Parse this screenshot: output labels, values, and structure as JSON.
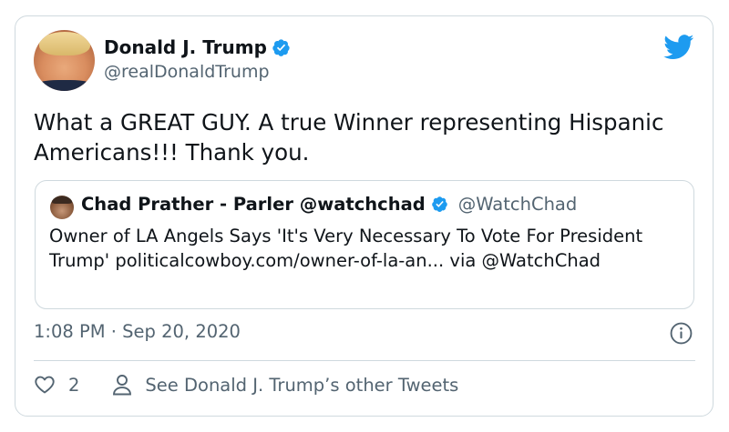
{
  "author": {
    "name": "Donald J. Trump",
    "handle": "@realDonaldTrump"
  },
  "tweet": {
    "text": "What a GREAT GUY. A true Winner representing Hispanic Americans!!! Thank you.",
    "timestamp": "1:08 PM · Sep 20, 2020"
  },
  "quoted": {
    "name": "Chad Prather - Parler @watchchad",
    "handle": "@WatchChad",
    "text": "Owner of LA Angels Says 'It's Very Necessary To Vote For President Trump' politicalcowboy.com/owner-of-la-an... via @WatchChad"
  },
  "actions": {
    "like_count": "2",
    "profile_label": "See Donald J. Trump’s other Tweets"
  },
  "colors": {
    "brand_blue": "#1d9bf0",
    "text_primary": "#0f1419",
    "text_secondary": "#536471",
    "border": "#cfd9de"
  },
  "icons": [
    "verified-badge-icon",
    "twitter-bird-icon",
    "info-icon",
    "heart-icon",
    "person-icon"
  ]
}
